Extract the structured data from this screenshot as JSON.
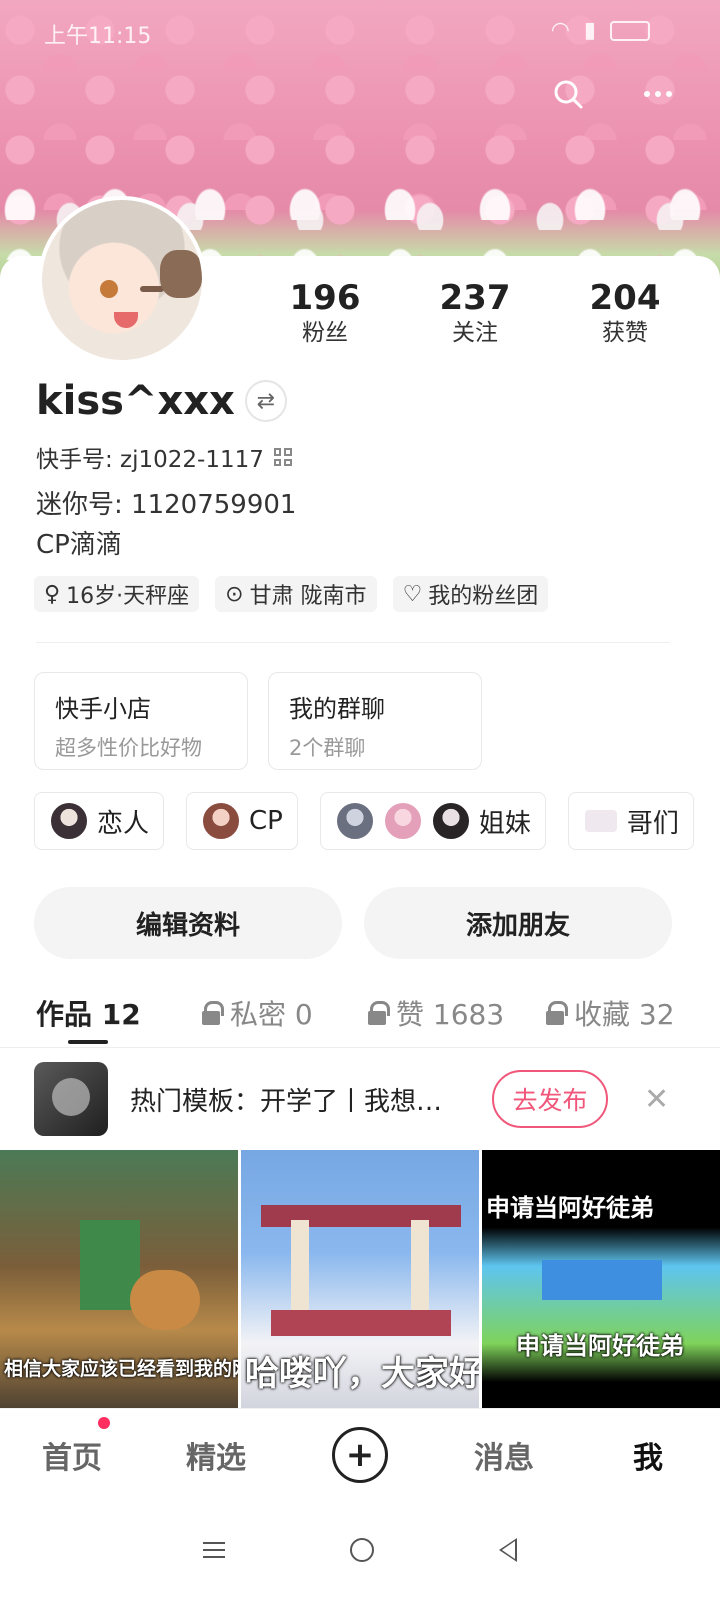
{
  "status_bar": {
    "time": "上午11:15"
  },
  "profile": {
    "followers": "196",
    "followers_label": "粉丝",
    "following": "237",
    "following_label": "关注",
    "likes": "204",
    "likes_label": "获赞",
    "name": "kiss^xxx",
    "kwai_id": "快手号: zj1022-1117",
    "mini_id": "迷你号:   1120759901",
    "bio": "CP滴滴",
    "tags": [
      "16岁·天秤座",
      "甘肃 陇南市",
      "我的粉丝团"
    ]
  },
  "cards": [
    {
      "title": "快手小店",
      "sub": "超多性价比好物"
    },
    {
      "title": "我的群聊",
      "sub": "2个群聊"
    }
  ],
  "relations": [
    "恋人",
    "CP",
    "姐妹",
    "哥们"
  ],
  "buttons": {
    "edit": "编辑资料",
    "add_friend": "添加朋友"
  },
  "tabs": [
    {
      "label": "作品 12"
    },
    {
      "label": "私密 0"
    },
    {
      "label": "赞 1683"
    },
    {
      "label": "收藏 32"
    }
  ],
  "promo": {
    "text": "热门模板：开学了丨我想…",
    "button": "去发布"
  },
  "videos": [
    {
      "caption": "相信大家应该已经看到我的网名了"
    },
    {
      "caption": "哈喽吖，大家好"
    },
    {
      "caption_top": "申请当阿好徒弟",
      "caption_mid": "申请当阿好徒弟"
    }
  ],
  "bottom_nav": [
    "首页",
    "精选",
    "消息",
    "我"
  ],
  "colors": {
    "accent": "#f0577a",
    "dot": "#ff2e5e"
  }
}
